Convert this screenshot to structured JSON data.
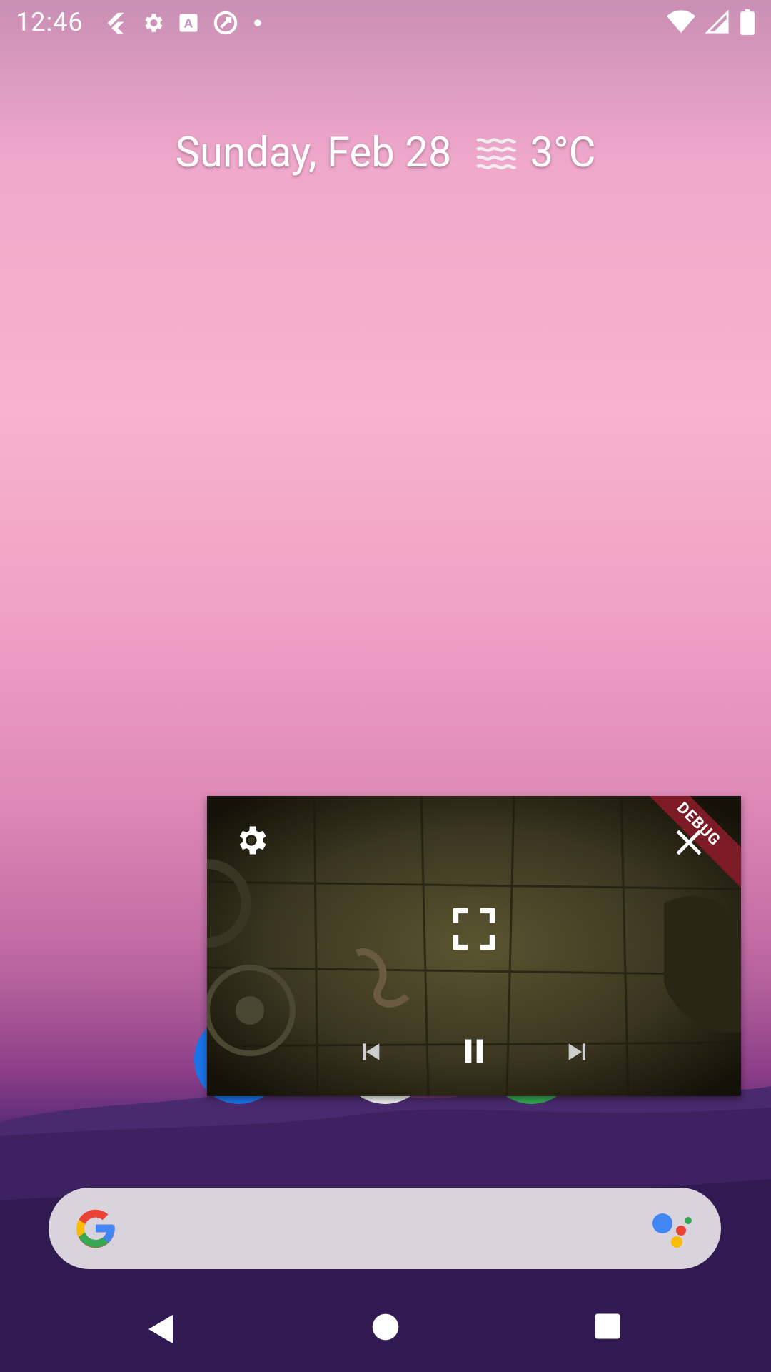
{
  "status_bar": {
    "time": "12:46",
    "left_icons": [
      "flutter-icon",
      "settings-icon",
      "font-a-icon",
      "app-circle-icon",
      "dot-icon"
    ],
    "right_icons": [
      "wifi-icon",
      "signal-icon",
      "battery-icon"
    ]
  },
  "glance": {
    "date": "Sunday, Feb 28",
    "weather_icon": "haze-icon",
    "temperature": "3°C"
  },
  "pip_player": {
    "debug_label": "DEBUG",
    "controls": [
      "settings-icon",
      "close-icon",
      "fullscreen-icon",
      "skip-previous-icon",
      "pause-icon",
      "skip-next-icon"
    ]
  },
  "search_bar": {
    "logo": "google-g-icon",
    "assistant": "assistant-icon"
  },
  "navigation": {
    "buttons": [
      "back-icon",
      "home-icon",
      "recents-icon"
    ]
  },
  "colors": {
    "debug_ribbon": "#7c1b26",
    "search_bar_bg": "#d9d3de"
  }
}
